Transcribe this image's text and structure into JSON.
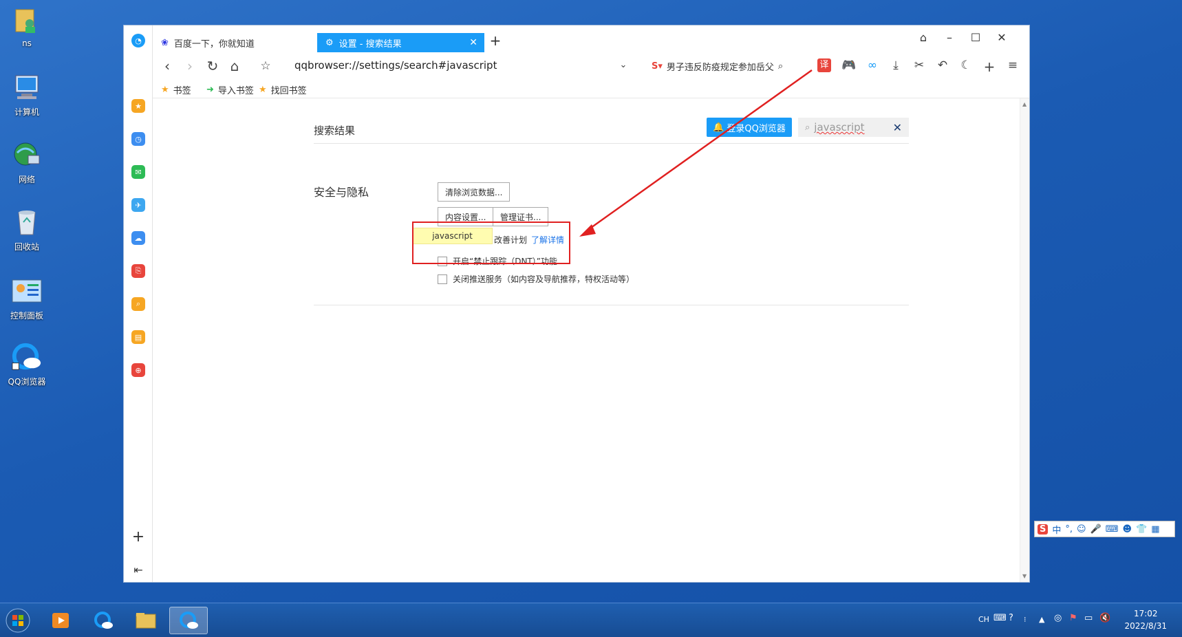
{
  "desktop": {
    "icons": [
      {
        "label": "ns",
        "icon": "user-folder-icon"
      },
      {
        "label": "计算机",
        "icon": "computer-icon"
      },
      {
        "label": "网络",
        "icon": "network-icon"
      },
      {
        "label": "回收站",
        "icon": "recycle-bin-icon"
      },
      {
        "label": "控制面板",
        "icon": "control-panel-icon"
      },
      {
        "label": "QQ浏览器",
        "icon": "qq-browser-icon"
      }
    ]
  },
  "browser": {
    "tabs": [
      {
        "label": "百度一下，你就知道",
        "icon": "baidu-paw-icon",
        "active": false
      },
      {
        "label": "设置 - 搜索结果",
        "icon": "settings-gear-icon",
        "active": true
      }
    ],
    "new_tab": "+",
    "address": "qqbrowser://settings/search#javascript",
    "search_text": "男子违反防疫规定参加岳父",
    "bookmarks": [
      {
        "label": "书签",
        "icon": "star-icon"
      },
      {
        "label": "导入书签",
        "icon": "import-icon"
      },
      {
        "label": "找回书签",
        "icon": "star-icon"
      }
    ],
    "translate_label": "译"
  },
  "settings": {
    "page_title": "搜索结果",
    "login_button": "登录QQ浏览器",
    "search_value": "javascript",
    "section_title": "安全与隐私",
    "buttons": {
      "clear_data": "清除浏览数据...",
      "content_settings": "内容设置...",
      "manage_certs": "管理证书..."
    },
    "highlight_text": "javascript",
    "rows": [
      {
        "text": "改善计划",
        "link": "了解详情"
      },
      {
        "text": "开启“禁止跟踪（DNT）”功能"
      },
      {
        "text": "关闭推送服务（如内容及导航推荐，特权活动等）"
      }
    ]
  },
  "ime": {
    "label": "中"
  },
  "taskbar": {
    "lang": "CH",
    "time": "17:02",
    "date": "2022/8/31"
  },
  "colors": {
    "accent": "#1a9cf7",
    "annotation": "#e02020",
    "desktop": "#1b5bb3"
  }
}
